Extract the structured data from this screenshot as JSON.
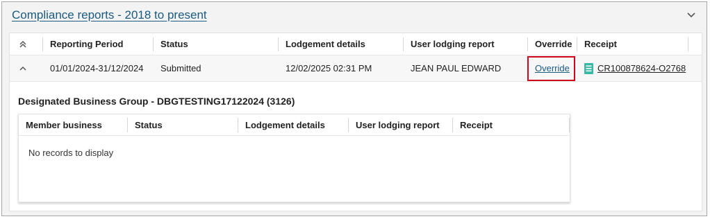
{
  "panel": {
    "title": "Compliance reports - 2018 to present"
  },
  "grid": {
    "columns": [
      "Reporting Period",
      "Status",
      "Lodgement details",
      "User lodging report",
      "Override",
      "Receipt"
    ],
    "row": {
      "reporting_period": "01/01/2024-31/12/2024",
      "status": "Submitted",
      "lodgement_details": "12/02/2025 02:31 PM",
      "user_lodging_report": "JEAN PAUL EDWARD",
      "override_link": "Override",
      "receipt_link": "CR100878624-O2768"
    }
  },
  "detail": {
    "group_title": "Designated Business Group - DBGTESTING17122024 (3126)",
    "columns": [
      "Member business",
      "Status",
      "Lodgement details",
      "User lodging report",
      "Receipt"
    ],
    "empty_message": "No records to display"
  },
  "colors": {
    "link": "#1b5a80",
    "highlight_border": "#d0021b",
    "receipt_icon": "#3ab7a5"
  }
}
